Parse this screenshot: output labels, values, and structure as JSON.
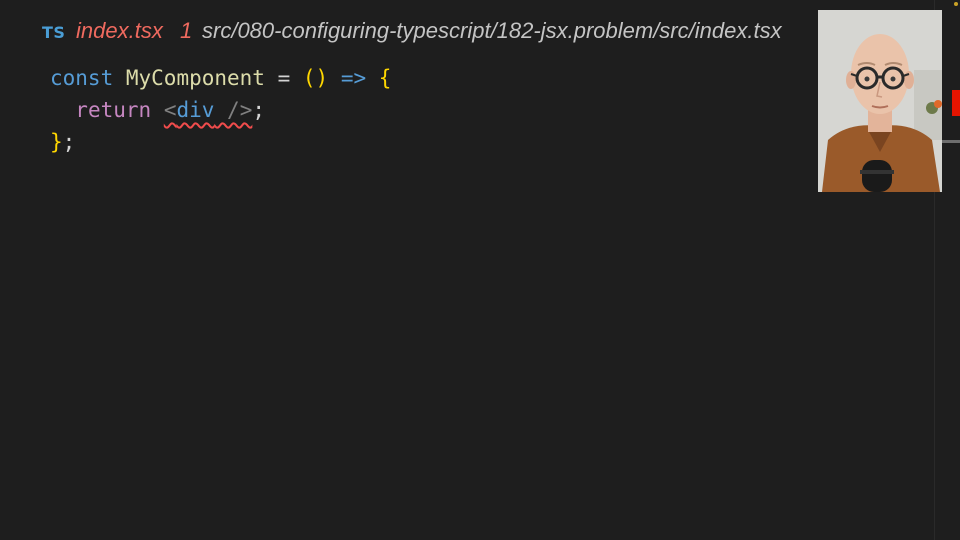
{
  "tab": {
    "language_badge": "TS",
    "file_name": "index.tsx",
    "problem_count": "1",
    "file_path": "src/080-configuring-typescript/182-jsx.problem/src/index.tsx"
  },
  "code": {
    "line1": {
      "kw": "const",
      "name": "MyComponent",
      "eq": " = ",
      "parens": "()",
      "arrow": " => ",
      "brace": "{"
    },
    "line2": {
      "indent": "  ",
      "kw": "return",
      "space": " ",
      "open": "<",
      "tag": "div",
      "close": " />",
      "semi": ";"
    },
    "line3": {
      "brace": "}",
      "semi": ";"
    }
  },
  "colors": {
    "background": "#1e1e1e",
    "error": "#f14c4c",
    "ts_badge": "#4a9ed6",
    "tab_file": "#ef6a5f"
  },
  "webcam": {
    "icon": "presenter-video-feed"
  }
}
